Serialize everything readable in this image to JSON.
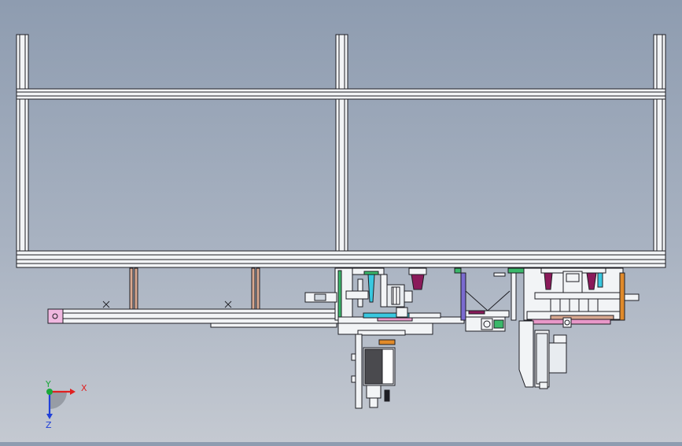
{
  "viewport": {
    "background_top": "#8e9cb0",
    "background_bottom": "#c4c9d1",
    "frame_color": "#f2f4f6",
    "edge_color": "#1e1e24"
  },
  "triad": {
    "x_label": "X",
    "y_label": "Y",
    "z_label": "Z",
    "x_color": "#e02020",
    "y_color": "#1aa83a",
    "z_color": "#2040d8"
  },
  "accent_colors": {
    "magenta": "#8a1a5a",
    "cyan": "#38c8e0",
    "orange": "#e08a2a",
    "purple": "#7a6ad0",
    "pink": "#e898c8",
    "copper": "#d8a890",
    "green": "#3ab86a"
  }
}
